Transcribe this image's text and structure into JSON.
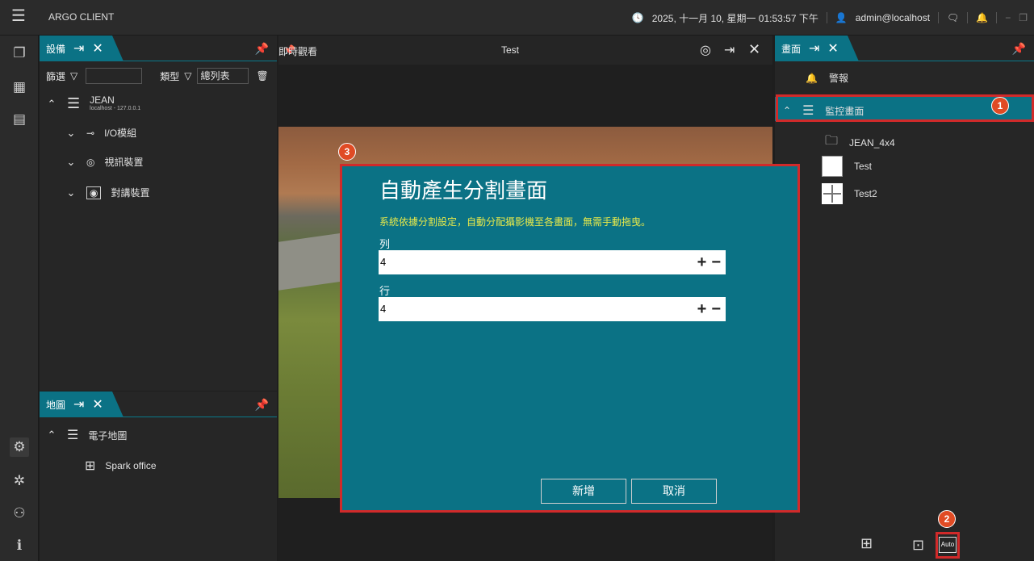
{
  "app": {
    "title": "ARGO CLIENT",
    "datetime": "2025, 十一月 10, 星期一 01:53:57 下午",
    "user": "admin@localhost"
  },
  "devices_panel": {
    "tab_label": "設備",
    "filter_label": "篩選",
    "filter_value": "",
    "type_label": "類型",
    "type_value": "總列表",
    "server_name": "JEAN",
    "server_host": "localhost - 127.0.0.1",
    "groups": [
      "I/O模組",
      "視訊裝置",
      "對講裝置"
    ]
  },
  "map_panel": {
    "tab_label": "地圖",
    "root_label": "電子地圖",
    "items": [
      "Spark office"
    ]
  },
  "center": {
    "tab_label": "即時觀看",
    "view_name": "Test"
  },
  "dialog": {
    "title": "自動產生分割畫面",
    "description": "系統依據分割設定，自動分配攝影機至各畫面，無需手動拖曳。",
    "columns_label": "列",
    "columns_value": "4",
    "rows_label": "行",
    "rows_value": "4",
    "plus": "+",
    "minus": "−",
    "add_button": "新增",
    "cancel_button": "取消"
  },
  "screens_panel": {
    "tab_label": "畫面",
    "alarm_label": "警報",
    "group_label": "監控畫面",
    "items": [
      "JEAN_4x4",
      "Test",
      "Test2"
    ],
    "auto_label": "Auto"
  },
  "badges": [
    "1",
    "2",
    "3"
  ],
  "colors": {
    "accent": "#0b7285",
    "highlight_border": "#d12a2a",
    "badge": "#e04b24",
    "description_text": "#e8e94a"
  }
}
